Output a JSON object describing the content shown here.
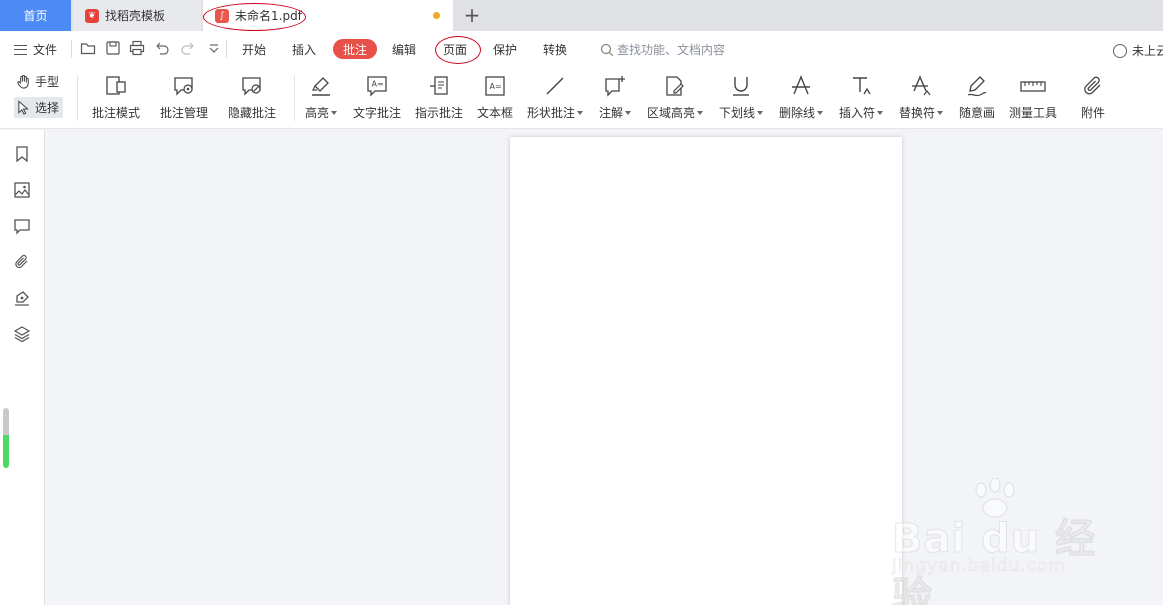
{
  "tabs": {
    "home": "首页",
    "templates": "找稻壳模板",
    "document": "未命名1.pdf",
    "add": "+"
  },
  "menu": {
    "file": "文件",
    "tabs": [
      "开始",
      "插入",
      "批注",
      "编辑",
      "页面",
      "保护",
      "转换"
    ],
    "active_tab": "批注",
    "search_placeholder": "查找功能、文档内容",
    "cloud_status": "未上云"
  },
  "modes": {
    "hand": "手型",
    "select": "选择"
  },
  "ribbon": {
    "annotation_mode": "批注模式",
    "annotation_manage": "批注管理",
    "hide_annotations": "隐藏批注",
    "highlight": "高亮",
    "text_annotation": "文字批注",
    "pointer_annotation": "指示批注",
    "text_box": "文本框",
    "shape_annotation": "形状批注",
    "note": "注解",
    "area_highlight": "区域高亮",
    "underline": "下划线",
    "strikethrough": "删除线",
    "insert_mark": "插入符",
    "replace_mark": "替换符",
    "freehand": "随意画",
    "measure_tool": "测量工具",
    "attachment": "附件"
  },
  "watermark": {
    "brand": "Bai du 经验",
    "url": "jingyan.baidu.com"
  },
  "colors": {
    "home_tab": "#4c8bf5",
    "active_menu": "#e8504a",
    "unsaved_dot": "#f5a623",
    "annotation_oval": "#d0021b"
  }
}
